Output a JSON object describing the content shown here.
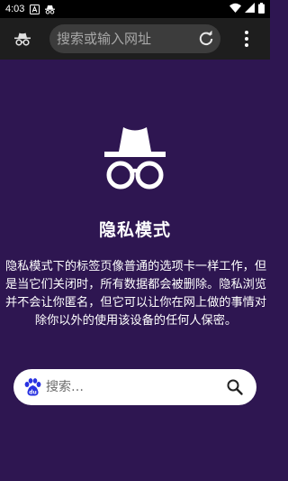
{
  "status_bar": {
    "time": "4:03",
    "icons_left": [
      "a-notification-icon",
      "incognito-notification-icon"
    ],
    "icons_right": [
      "wifi-icon",
      "cellular-signal-icon",
      "battery-icon"
    ]
  },
  "toolbar": {
    "incognito_icon": "incognito-icon",
    "omnibox_placeholder": "搜索或输入网址",
    "reload_icon": "reload-icon",
    "menu_icon": "more-vert-icon"
  },
  "ntp": {
    "hero_icon": "incognito-hat-glasses-icon",
    "title": "隐私模式",
    "description": "隐私模式下的标签页像普通的选项卡一样工作，但是当它们关闭时，所有数据都会被删除。隐私浏览并不会让你匿名，但它可以让你在网上做的事情对除你以外的使用该设备的任何人保密。",
    "search_placeholder": "搜索…",
    "search_engine_icon": "baidu-paw-icon",
    "search_icon": "search-icon"
  },
  "colors": {
    "background": "#2e1651",
    "toolbar": "#1e1e1e",
    "omnibox": "#3c3c3c",
    "baidu_blue": "#2932e1"
  }
}
